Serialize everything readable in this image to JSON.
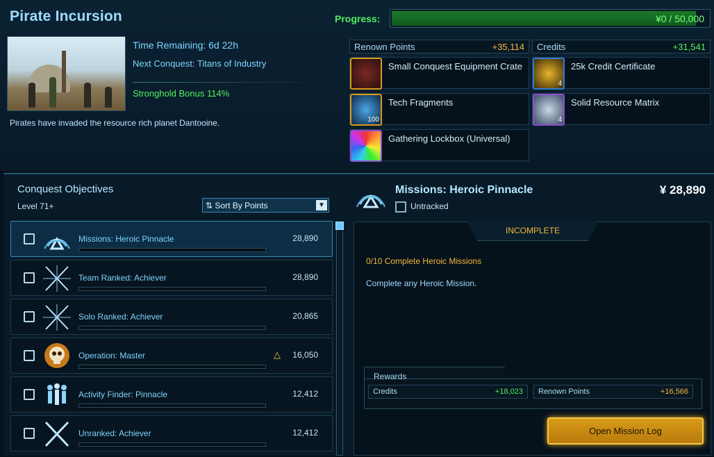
{
  "header": {
    "title": "Pirate Incursion",
    "progress_label": "Progress:",
    "progress_text": "¥0 / 50,000",
    "progress_fraction": 0.96
  },
  "info": {
    "time_remaining": "Time Remaining: 6d 22h",
    "next_conquest": "Next Conquest: Titans of Industry",
    "stronghold_bonus": "Stronghold Bonus 114%",
    "description": "Pirates have invaded the resource rich planet Dantooine."
  },
  "stats": {
    "renown_label": "Renown Points",
    "renown_value": "+35,114",
    "credits_label": "Credits",
    "credits_value": "+31,541"
  },
  "rewards": [
    {
      "name": "Small Conquest Equipment Crate",
      "qty": "",
      "icon": "crate-icon",
      "border": "#d59a1a"
    },
    {
      "name": "25k Credit Certificate",
      "qty": "4",
      "icon": "credit-certificate-icon",
      "border": "#2f7fd1"
    },
    {
      "name": "Tech Fragments",
      "qty": "100",
      "icon": "tech-fragments-icon",
      "border": "#d59a1a"
    },
    {
      "name": "Solid Resource Matrix",
      "qty": "4",
      "icon": "resource-matrix-icon",
      "border": "#8a4fd1"
    },
    {
      "name": "Gathering Lockbox (Universal)",
      "qty": "",
      "icon": "lockbox-icon",
      "border": "#8a4fd1"
    }
  ],
  "objectives": {
    "title": "Conquest Objectives",
    "level": "Level 71+",
    "sort_label": "Sort By Points",
    "items": [
      {
        "name": "Missions: Heroic Pinnacle",
        "points": "28,890",
        "icon": "heroic-pinnacle-icon"
      },
      {
        "name": "Team Ranked: Achiever",
        "points": "28,890",
        "icon": "crossed-blades-icon"
      },
      {
        "name": "Solo Ranked: Achiever",
        "points": "20,865",
        "icon": "crossed-blades-icon"
      },
      {
        "name": "Operation: Master",
        "points": "16,050",
        "icon": "skull-icon"
      },
      {
        "name": "Activity Finder: Pinnacle",
        "points": "12,412",
        "icon": "group-icon"
      },
      {
        "name": "Unranked: Achiever",
        "points": "12,412",
        "icon": "crossed-swords-icon"
      }
    ]
  },
  "detail": {
    "title": "Missions: Heroic Pinnacle",
    "points": "¥ 28,890",
    "untracked_label": "Untracked",
    "status": "INCOMPLETE",
    "objective_line": "0/10 Complete Heroic Missions",
    "objective_desc": "Complete any Heroic Mission.",
    "rewards_title": "Rewards",
    "reward_credits_label": "Credits",
    "reward_credits_value": "+18,023",
    "reward_renown_label": "Renown Points",
    "reward_renown_value": "+16,566",
    "open_button": "Open Mission Log"
  },
  "colors": {
    "accent": "#7fd3ff",
    "positive": "#53f25f",
    "warning": "#f5b73b",
    "button": "#d79b17"
  }
}
